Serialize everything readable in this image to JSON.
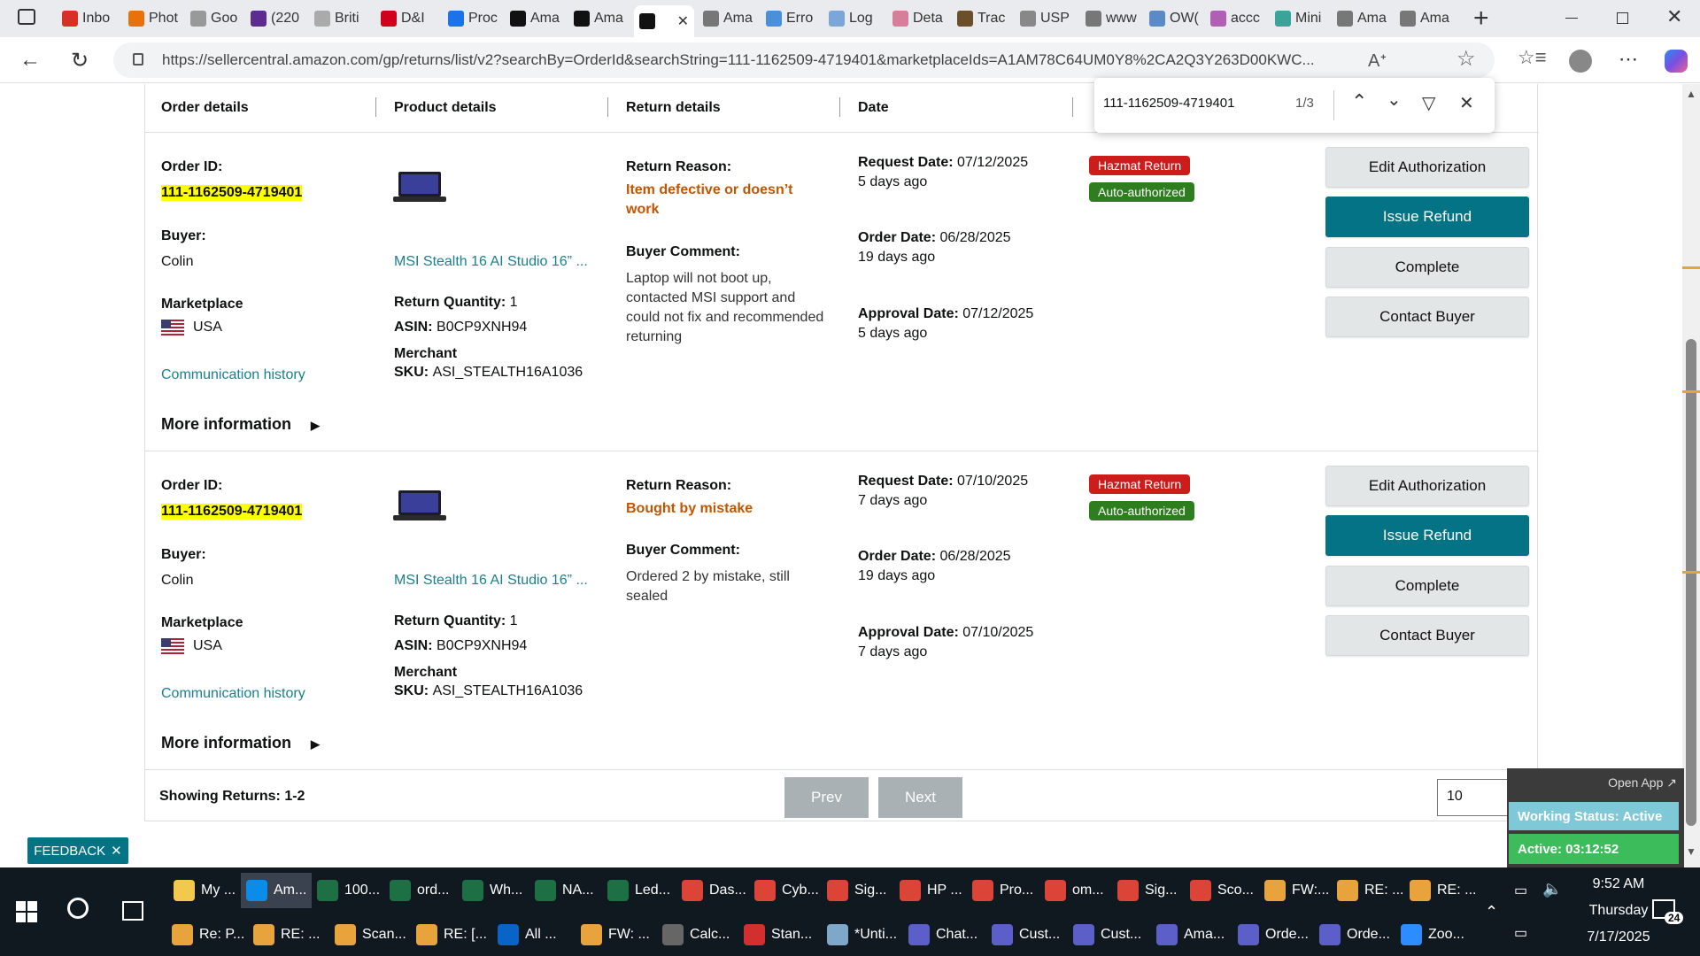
{
  "browser": {
    "tabs": [
      {
        "label": "Inbo",
        "color": "#d93025"
      },
      {
        "label": "Phot",
        "color": "#e8710a"
      },
      {
        "label": "Goo",
        "color": "#999999"
      },
      {
        "label": "(220",
        "color": "#5c2d91"
      },
      {
        "label": "Briti",
        "color": "#aaaaaa"
      },
      {
        "label": "D&I",
        "color": "#d0021b"
      },
      {
        "label": "Proc",
        "color": "#1a73e8"
      },
      {
        "label": "Ama",
        "color": "#111111"
      },
      {
        "label": "Ama",
        "color": "#111111"
      },
      {
        "label": "",
        "color": "#111111",
        "active": true
      },
      {
        "label": "Ama",
        "color": "#777777"
      },
      {
        "label": "Erro",
        "color": "#4a90d9"
      },
      {
        "label": "Log",
        "color": "#7aa7d8"
      },
      {
        "label": "Deta",
        "color": "#d57f9b"
      },
      {
        "label": "Trac",
        "color": "#6b4f2a"
      },
      {
        "label": "USP",
        "color": "#888888"
      },
      {
        "label": "www",
        "color": "#777777"
      },
      {
        "label": "OW(",
        "color": "#5b8bc7"
      },
      {
        "label": "accc",
        "color": "#b05fb5"
      },
      {
        "label": "Mini",
        "color": "#3aa39a"
      },
      {
        "label": "Ama",
        "color": "#777777"
      },
      {
        "label": "Ama",
        "color": "#777777"
      }
    ],
    "new_tab": "+",
    "url": "https://sellercentral.amazon.com/gp/returns/list/v2?searchBy=OrderId&searchString=111-1162509-4719401&marketplaceIds=A1AM78C64UM0Y8%2CA2Q3Y263D00KWC..."
  },
  "find": {
    "query": "111-1162509-4719401",
    "count": "1/3"
  },
  "table": {
    "headers": [
      "Order details",
      "Product details",
      "Return details",
      "Date"
    ],
    "rows": [
      {
        "order_id_label": "Order ID:",
        "order_id": "111-1162509-4719401",
        "buyer_label": "Buyer:",
        "buyer": "Colin",
        "marketplace_label": "Marketplace",
        "marketplace": "USA",
        "comm": "Communication history",
        "more": "More information",
        "product": "MSI Stealth 16 AI Studio 16” ...",
        "qty_label": "Return Quantity:",
        "qty": "1",
        "asin_label": "ASIN:",
        "asin": "B0CP9XNH94",
        "merchant_label": "Merchant",
        "sku_label": "SKU:",
        "sku": "ASI_STEALTH16A1036",
        "reason_label": "Return Reason:",
        "reason_l1": "Item defective or doesn’t",
        "reason_l2": "work",
        "comment_label": "Buyer Comment:",
        "comment_lines": [
          "Laptop will not boot up,",
          "contacted MSI support and",
          "could not fix and recommended",
          "returning"
        ],
        "request_label": "Request Date:",
        "request_date": "07/12/2025",
        "request_ago": "5 days ago",
        "order_date_label": "Order Date:",
        "order_date": "06/28/2025",
        "order_ago": "19 days ago",
        "approval_label": "Approval Date:",
        "approval_date": "07/12/2025",
        "approval_ago": "5 days ago",
        "badge1": "Hazmat Return",
        "badge2": "Auto-authorized",
        "btn_edit": "Edit Authorization",
        "btn_refund": "Issue Refund",
        "btn_complete": "Complete",
        "btn_contact": "Contact Buyer"
      },
      {
        "order_id_label": "Order ID:",
        "order_id": "111-1162509-4719401",
        "buyer_label": "Buyer:",
        "buyer": "Colin",
        "marketplace_label": "Marketplace",
        "marketplace": "USA",
        "comm": "Communication history",
        "more": "More information",
        "product": "MSI Stealth 16 AI Studio 16” ...",
        "qty_label": "Return Quantity:",
        "qty": "1",
        "asin_label": "ASIN:",
        "asin": "B0CP9XNH94",
        "merchant_label": "Merchant",
        "sku_label": "SKU:",
        "sku": "ASI_STEALTH16A1036",
        "reason_label": "Return Reason:",
        "reason_l1": "Bought by mistake",
        "reason_l2": "",
        "comment_label": "Buyer Comment:",
        "comment_lines": [
          "Ordered 2 by mistake, still",
          "sealed",
          "",
          ""
        ],
        "request_label": "Request Date:",
        "request_date": "07/10/2025",
        "request_ago": "7 days ago",
        "order_date_label": "Order Date:",
        "order_date": "06/28/2025",
        "order_ago": "19 days ago",
        "approval_label": "Approval Date:",
        "approval_date": "07/10/2025",
        "approval_ago": "7 days ago",
        "badge1": "Hazmat Return",
        "badge2": "Auto-authorized",
        "btn_edit": "Edit Authorization",
        "btn_refund": "Issue Refund",
        "btn_complete": "Complete",
        "btn_contact": "Contact Buyer"
      }
    ]
  },
  "pagination": {
    "showing": "Showing Returns: 1-2",
    "prev": "Prev",
    "next": "Next",
    "page_size": "10"
  },
  "feedback": {
    "label": "FEEDBACK",
    "close": "✕"
  },
  "widget": {
    "open_app": "Open App ↗",
    "working_status": "Working Status: Active",
    "active_timer": "Active: 03:12:52"
  },
  "taskbar": {
    "row1": [
      {
        "label": "My ...",
        "color": "#f2c94c"
      },
      {
        "label": "Am...",
        "color": "#0c8ce9"
      },
      {
        "label": "100...",
        "color": "#1d7044"
      },
      {
        "label": "ord...",
        "color": "#1d7044"
      },
      {
        "label": "Wh...",
        "color": "#1d7044"
      },
      {
        "label": "NA...",
        "color": "#1d7044"
      },
      {
        "label": "Led...",
        "color": "#1d7044"
      },
      {
        "label": "Das...",
        "color": "#db4437"
      },
      {
        "label": "Cyb...",
        "color": "#db4437"
      },
      {
        "label": "Sig...",
        "color": "#db4437"
      },
      {
        "label": "HP ...",
        "color": "#db4437"
      },
      {
        "label": "Pro...",
        "color": "#db4437"
      },
      {
        "label": "om...",
        "color": "#db4437"
      },
      {
        "label": "Sig...",
        "color": "#db4437"
      },
      {
        "label": "Sco...",
        "color": "#db4437"
      },
      {
        "label": "FW:...",
        "color": "#e8a33d"
      },
      {
        "label": "RE: ...",
        "color": "#e8a33d"
      },
      {
        "label": "RE: ...",
        "color": "#e8a33d"
      }
    ],
    "row2": [
      {
        "label": "Re: P...",
        "color": "#e8a33d"
      },
      {
        "label": "RE: ...",
        "color": "#e8a33d"
      },
      {
        "label": "Scan...",
        "color": "#e8a33d"
      },
      {
        "label": "RE: [...",
        "color": "#e8a33d"
      },
      {
        "label": "All ...",
        "color": "#0a64c8"
      },
      {
        "label": "FW: ...",
        "color": "#e8a33d"
      },
      {
        "label": "Calc...",
        "color": "#666666"
      },
      {
        "label": "Stan...",
        "color": "#d32f2f"
      },
      {
        "label": "*Unti...",
        "color": "#7fa7c8"
      },
      {
        "label": "Chat...",
        "color": "#5b5fc7"
      },
      {
        "label": "Cust...",
        "color": "#5b5fc7"
      },
      {
        "label": "Cust...",
        "color": "#5b5fc7"
      },
      {
        "label": "Ama...",
        "color": "#5b5fc7"
      },
      {
        "label": "Orde...",
        "color": "#5b5fc7"
      },
      {
        "label": "Orde...",
        "color": "#5b5fc7"
      },
      {
        "label": "Zoo...",
        "color": "#2d8cff"
      }
    ],
    "time": "9:52 AM",
    "day": "Thursday",
    "date": "7/17/2025",
    "notif": "24"
  }
}
